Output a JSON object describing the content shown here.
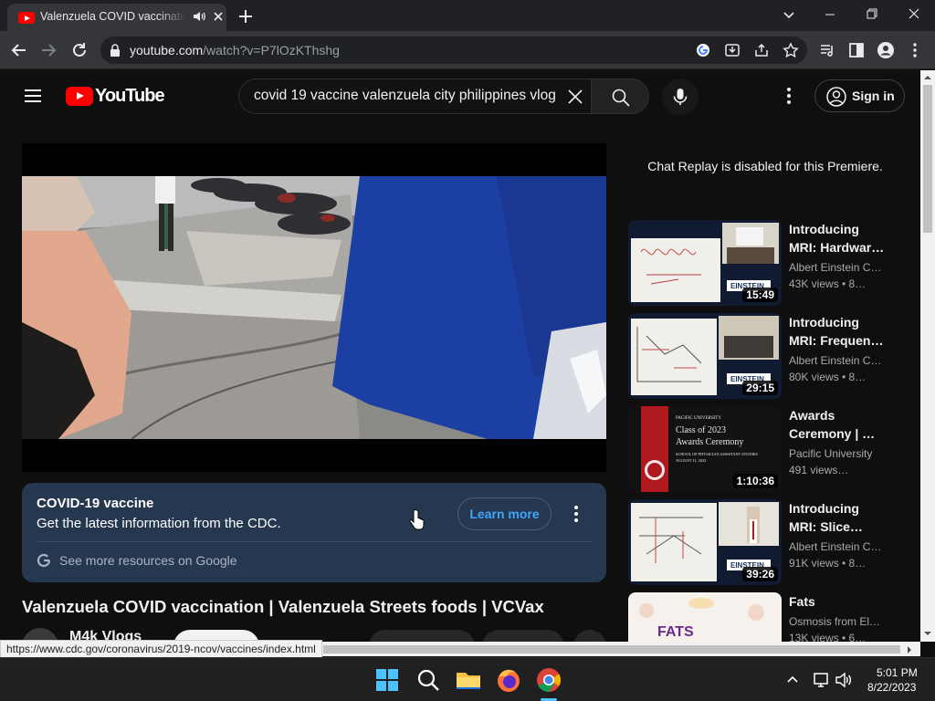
{
  "browser": {
    "tab_title": "Valenzuela COVID vaccination | Valenzuela Streets foods | VCVax",
    "url_host": "youtube.com",
    "url_path": "/watch?v=P7lOzKThshg"
  },
  "header": {
    "logo_text": "YouTube",
    "search_value": "covid 19 vaccine valenzuela city philippines vlog",
    "signin_label": "Sign in"
  },
  "info_panel": {
    "title": "COVID-19 vaccine",
    "subtitle": "Get the latest information from the CDC.",
    "learn_more": "Learn more",
    "google_link": "See more resources on Google"
  },
  "video": {
    "title": "Valenzuela COVID vaccination | Valenzuela Streets foods | VCVax",
    "channel": "M4k Vlogs"
  },
  "sidebar": {
    "chat_replay": "Chat Replay is disabled for this Premiere.",
    "recs": [
      {
        "title": "Introducing MRI: Hardwar…",
        "channel": "Albert Einstein C…",
        "meta": "43K views  •  8…",
        "duration": "15:49",
        "thumb_label": "EINSTEIN"
      },
      {
        "title": "Introducing MRI: Frequen…",
        "channel": "Albert Einstein C…",
        "meta": "80K views  •  8…",
        "duration": "29:15",
        "thumb_label": "EINSTEIN"
      },
      {
        "title": "Awards Ceremony | …",
        "channel": "Pacific University",
        "meta": "491 views…",
        "duration": "1:10:36",
        "thumb_lines": [
          "PACIFIC UNIVERSITY",
          "Class of 2023",
          "Awards Ceremony",
          "SCHOOL OF PHYSICIAN ASSISTANT STUDIES",
          "AUGUST 11, 2023"
        ]
      },
      {
        "title": "Introducing MRI: Slice…",
        "channel": "Albert Einstein C…",
        "meta": "91K views  •  8…",
        "duration": "39:26",
        "thumb_label": "EINSTEIN"
      },
      {
        "title": "Fats",
        "channel": "Osmosis from El…",
        "meta": "13K views  •  6…",
        "duration": "",
        "thumb_label": "FATS"
      }
    ]
  },
  "status_bar_url": "https://www.cdc.gov/coronavirus/2019-ncov/vaccines/index.html",
  "taskbar": {
    "time": "5:01 PM",
    "date": "8/22/2023"
  }
}
